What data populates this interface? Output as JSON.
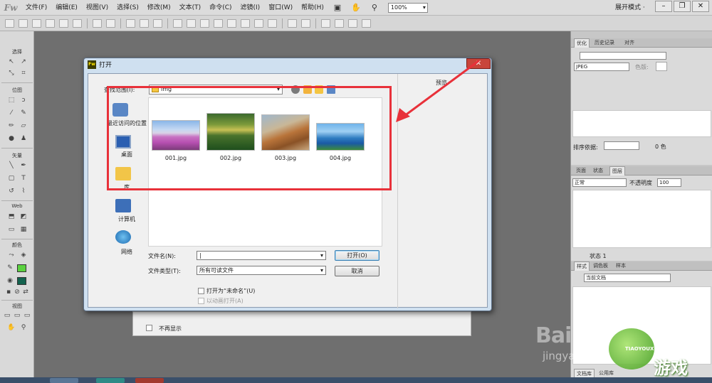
{
  "app": {
    "logo": "Fw"
  },
  "menubar": {
    "items": [
      "文件(F)",
      "编辑(E)",
      "视图(V)",
      "选择(S)",
      "修改(M)",
      "文本(T)",
      "命令(C)",
      "滤镜(I)",
      "窗口(W)",
      "帮助(H)"
    ],
    "zoom": "100%",
    "workspace": "展开模式 ·",
    "window_controls": [
      "–",
      "❐",
      "✕"
    ]
  },
  "tools_panel": {
    "sections": [
      "选择",
      "位图",
      "矢量",
      "Web",
      "颜色",
      "视图"
    ],
    "colors": {
      "stroke": "#5bd13f",
      "fill": "#13624e"
    }
  },
  "right_panels": {
    "top_tabs": [
      "优化",
      "历史记录",
      "对齐"
    ],
    "format": "JPEG",
    "color_label": "色版:",
    "sort_label": "排序依据:",
    "colors_count": "0 色",
    "mid_tabs": [
      "页面",
      "状态",
      "图层"
    ],
    "blend_mode": "正常",
    "opacity_label": "不透明度",
    "opacity_value": "100",
    "state_label": "状态 1",
    "bottom_tabs": [
      "样式",
      "调色板",
      "样本"
    ],
    "styles_source": "当前文档",
    "footer_tabs": [
      "文档库",
      "公用库"
    ]
  },
  "dialog": {
    "title": "打开",
    "close_label": "✕",
    "look_in_label": "查找范围(I):",
    "folder": "img",
    "preview_label": "预览",
    "places": [
      "最近访问的位置",
      "桌面",
      "库",
      "计算机",
      "网络"
    ],
    "files": [
      {
        "name": "001.jpg"
      },
      {
        "name": "002.jpg"
      },
      {
        "name": "003.jpg"
      },
      {
        "name": "004.jpg"
      }
    ],
    "filename_label": "文件名(N):",
    "filename_value": "|",
    "filetype_label": "文件类型(T):",
    "filetype_value": "所有可读文件",
    "open_button": "打开(O)",
    "cancel_button": "取消",
    "open_as_untitled": "打开为“未命名”(U)",
    "open_as_animation": "以动画打开(A)"
  },
  "behind": {
    "dont_show": "不再显示"
  },
  "annotation": {
    "color": "#e8313a"
  },
  "watermarks": {
    "baidu": "Bai",
    "jingyan": "jingyan",
    "site_text": "游戏",
    "site_small": "TIAOYOUXIWANG",
    "site_domain": "xiayx.com"
  }
}
